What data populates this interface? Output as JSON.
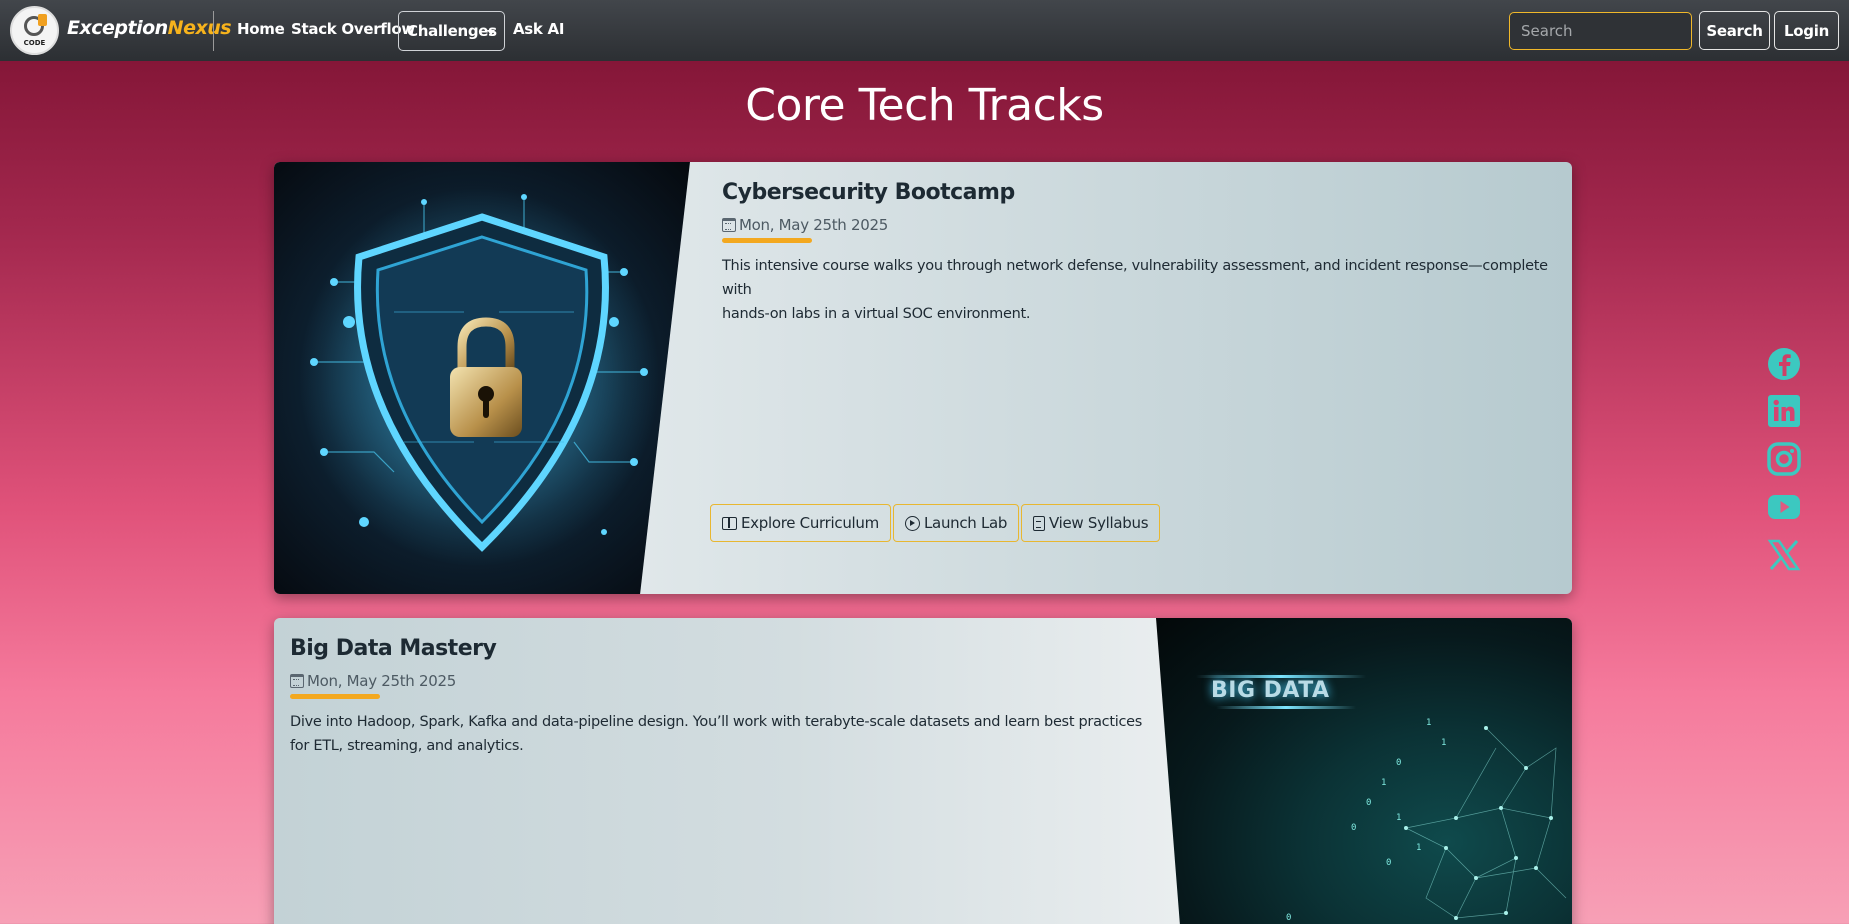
{
  "brand": {
    "logo_text": "CODE",
    "name_part1": "Exception",
    "name_part2": "Nexus"
  },
  "nav": {
    "home": "Home",
    "stack_overflow": "Stack Overflow",
    "challenges": "Challenges",
    "ask_ai": "Ask AI",
    "search_placeholder": "Search",
    "search_button": "Search",
    "login_button": "Login"
  },
  "page": {
    "title": "Core Tech Tracks"
  },
  "cards": [
    {
      "title": "Cybersecurity Bootcamp",
      "date": "Mon, May 25th 2025",
      "description_line1": "This intensive course walks you through network defense, vulnerability assessment, and incident response—complete with",
      "description_line2": "hands-on labs in a virtual SOC environment.",
      "buttons": [
        "Explore Curriculum",
        "Launch Lab",
        "View Syllabus"
      ],
      "image_icon": "shield-lock-icon"
    },
    {
      "title": "Big Data Mastery",
      "date": "Mon, May 25th 2025",
      "description_line1": "Dive into Hadoop, Spark, Kafka and data-pipeline design. You’ll work with terabyte-scale datasets and learn best practices",
      "description_line2": "for ETL, streaming, and analytics.",
      "image_text": "BIG DATA"
    }
  ],
  "social": [
    "facebook-icon",
    "linkedin-icon",
    "instagram-icon",
    "youtube-icon",
    "x-icon"
  ],
  "colors": {
    "accent": "#f3a81f",
    "social": "#3cc8c0",
    "navbar": "#343a40"
  }
}
